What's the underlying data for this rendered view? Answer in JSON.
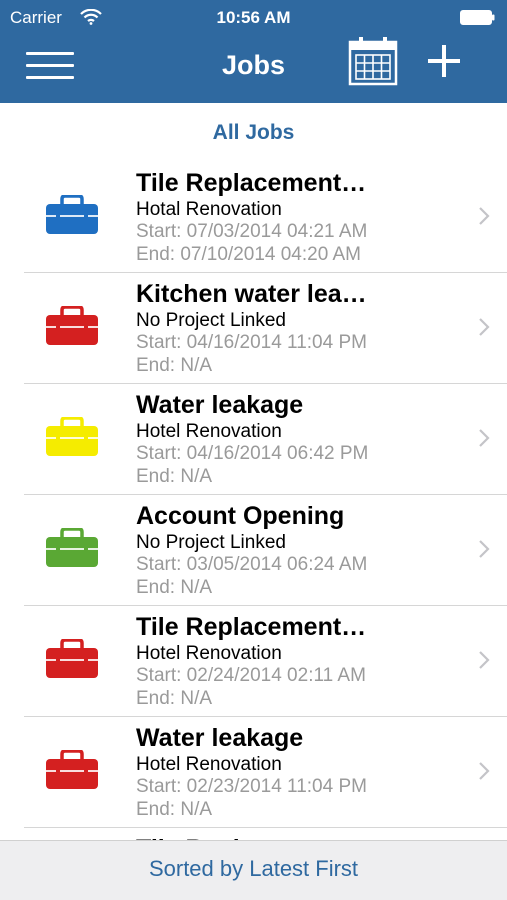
{
  "status_bar": {
    "carrier": "Carrier",
    "time": "10:56 AM"
  },
  "nav": {
    "title": "Jobs"
  },
  "section_title": "All Jobs",
  "colors": {
    "blue": "#1f6fc2",
    "red": "#d42020",
    "yellow": "#f5ec00",
    "green": "#5aa834",
    "header": "#2f69a0"
  },
  "jobs": [
    {
      "title": "Tile Replacement…",
      "project": "Hotal Renovation",
      "start": "Start: 07/03/2014 04:21 AM",
      "end": "End: 07/10/2014 04:20 AM",
      "color": "#1f6fc2"
    },
    {
      "title": "Kitchen water lea…",
      "project": "No Project Linked",
      "start": "Start: 04/16/2014 11:04 PM",
      "end": "End: N/A",
      "color": "#d42020"
    },
    {
      "title": "Water leakage",
      "project": "Hotel Renovation",
      "start": "Start: 04/16/2014 06:42 PM",
      "end": "End: N/A",
      "color": "#f5ec00"
    },
    {
      "title": "Account Opening",
      "project": "No Project Linked",
      "start": "Start: 03/05/2014 06:24 AM",
      "end": "End: N/A",
      "color": "#5aa834"
    },
    {
      "title": "Tile Replacement…",
      "project": "Hotel Renovation",
      "start": "Start: 02/24/2014 02:11 AM",
      "end": "End: N/A",
      "color": "#d42020"
    },
    {
      "title": "Water leakage",
      "project": "Hotel Renovation",
      "start": "Start: 02/23/2014 11:04 PM",
      "end": "End: N/A",
      "color": "#d42020"
    },
    {
      "title": "Tile Replacement…",
      "project": "",
      "start": "",
      "end": "",
      "color": "#d42020"
    }
  ],
  "footer": {
    "label": "Sorted by Latest First"
  }
}
